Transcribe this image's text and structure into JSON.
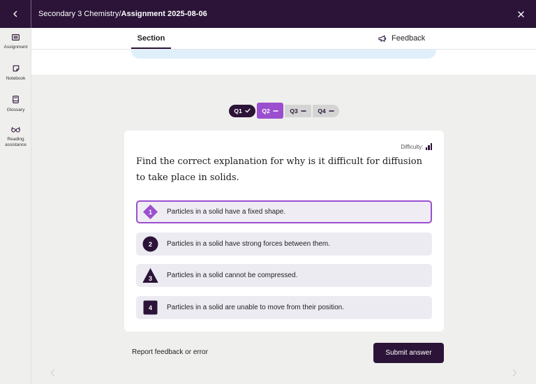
{
  "header": {
    "breadcrumb_parent": "Secondary 3 Chemistry",
    "breadcrumb_separator": "/",
    "breadcrumb_current": "Assignment 2025-08-06",
    "back_icon": "chevron-left-icon",
    "close_icon": "close-icon"
  },
  "sidebar": {
    "items": [
      {
        "label": "Assignment",
        "icon": "assignment-icon"
      },
      {
        "label": "Notebook",
        "icon": "notebook-icon"
      },
      {
        "label": "Glossary",
        "icon": "glossary-icon"
      },
      {
        "label": "Reading assistance",
        "icon": "reading-glasses-icon"
      }
    ]
  },
  "tabs": {
    "section_label": "Section",
    "feedback_label": "Feedback",
    "feedback_icon": "megaphone-icon"
  },
  "question_nav": {
    "items": [
      {
        "label": "Q1",
        "status": "answered"
      },
      {
        "label": "Q2",
        "status": "current"
      },
      {
        "label": "Q3",
        "status": "unanswered"
      },
      {
        "label": "Q4",
        "status": "unanswered"
      }
    ]
  },
  "question": {
    "difficulty_label": "Difficulty:",
    "text": "Find the correct explanation for why is it difficult for diffusion to take place in solids.",
    "options": [
      {
        "number": "1",
        "shape": "diamond",
        "text": "Particles in a solid have a fixed shape.",
        "selected": true
      },
      {
        "number": "2",
        "shape": "circle",
        "text": "Particles in a solid have strong forces between them.",
        "selected": false
      },
      {
        "number": "3",
        "shape": "triangle",
        "text": "Particles in a solid cannot be compressed.",
        "selected": false
      },
      {
        "number": "4",
        "shape": "square",
        "text": "Particles in a solid are unable to move from their position.",
        "selected": false
      }
    ]
  },
  "footer": {
    "report_label": "Report feedback or error",
    "submit_label": "Submit answer"
  },
  "colors": {
    "brand_dark": "#2b1438",
    "accent_purple": "#9b4fcf",
    "option_bg": "#edebf2",
    "banner_blue": "#dff0fb"
  }
}
